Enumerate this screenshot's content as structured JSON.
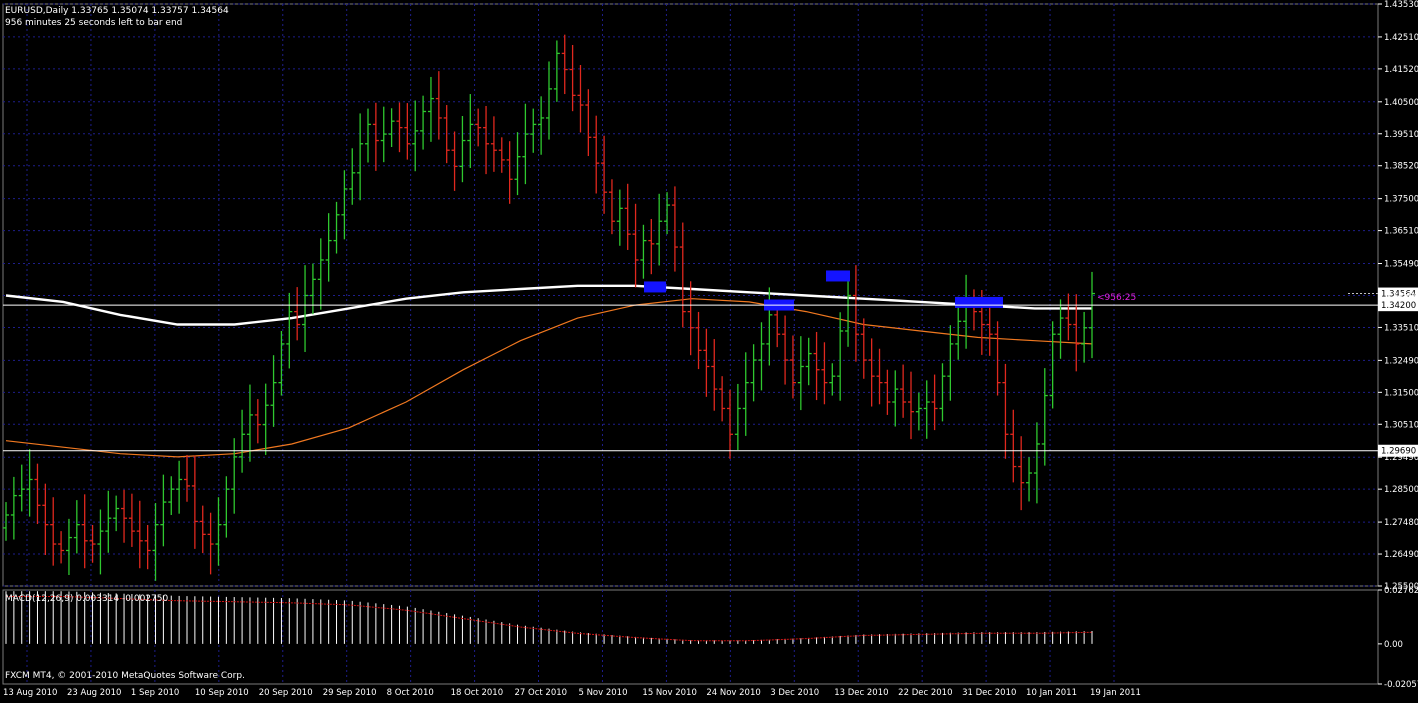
{
  "header": {
    "symbol_line": "EURUSD,Daily  1.33765 1.35074 1.33757 1.34564",
    "timer_line": "956 minutes 25 seconds left to bar end"
  },
  "colors": {
    "background": "#000000",
    "grid": "#1e1e8c",
    "bull_bar": "#2fc82f",
    "bear_bar": "#e0281e",
    "ma_fast": "#ffffff",
    "ma_slow": "#f07820",
    "marker": "#1414ff",
    "price_line": "#ffffff",
    "countdown_text": "#e020e0",
    "macd_hist": "#ffffff",
    "macd_signal": "#d01414",
    "axis_text": "#ffffff"
  },
  "main_chart": {
    "y_ticks": [
      "1.43530",
      "1.42510",
      "1.41520",
      "1.40500",
      "1.39510",
      "1.38520",
      "1.37500",
      "1.36510",
      "1.35490",
      "1.34500",
      "1.33510",
      "1.32490",
      "1.31500",
      "1.30510",
      "1.29490",
      "1.28500",
      "1.27480",
      "1.26490",
      "1.25500"
    ],
    "current_price_label": "1.34564",
    "hline_upper_label": "1.34200",
    "hline_lower_label": "1.29690",
    "countdown_label": "<956:25",
    "ylim": [
      1.255,
      1.4353
    ]
  },
  "macd_panel": {
    "label": "MACD(12,26,9) 0.003314 -0.002750",
    "y_ticks": [
      "0.02762",
      "0.00",
      "-0.02057"
    ]
  },
  "x_axis": {
    "labels": [
      "13 Aug 2010",
      "23 Aug 2010",
      "1 Sep 2010",
      "10 Sep 2010",
      "20 Sep 2010",
      "29 Sep 2010",
      "8 Oct 2010",
      "18 Oct 2010",
      "27 Oct 2010",
      "5 Nov 2010",
      "15 Nov 2010",
      "24 Nov 2010",
      "3 Dec 2010",
      "13 Dec 2010",
      "22 Dec 2010",
      "31 Dec 2010",
      "10 Jan 2011",
      "19 Jan 2011"
    ]
  },
  "copyright": "FXCM MT4, © 2001-2010 MetaQuotes Software Corp.",
  "chart_data": {
    "type": "ohlc",
    "title": "EURUSD,Daily",
    "ylim": [
      1.255,
      1.4353
    ],
    "ohlc_closes": [
      1.277,
      1.283,
      1.285,
      1.288,
      1.28,
      1.274,
      1.268,
      1.266,
      1.27,
      1.274,
      1.269,
      1.268,
      1.272,
      1.276,
      1.279,
      1.276,
      1.272,
      1.269,
      1.266,
      1.274,
      1.281,
      1.285,
      1.288,
      1.286,
      1.275,
      1.271,
      1.268,
      1.274,
      1.285,
      1.295,
      1.302,
      1.308,
      1.305,
      1.311,
      1.318,
      1.33,
      1.34,
      1.336,
      1.345,
      1.35,
      1.356,
      1.362,
      1.37,
      1.378,
      1.383,
      1.392,
      1.398,
      1.393,
      1.395,
      1.399,
      1.397,
      1.392,
      1.396,
      1.402,
      1.406,
      1.4,
      1.39,
      1.385,
      1.393,
      1.398,
      1.397,
      1.392,
      1.39,
      1.387,
      1.381,
      1.388,
      1.395,
      1.398,
      1.4,
      1.409,
      1.42,
      1.415,
      1.407,
      1.404,
      1.394,
      1.386,
      1.377,
      1.368,
      1.372,
      1.364,
      1.356,
      1.362,
      1.361,
      1.368,
      1.373,
      1.36,
      1.34,
      1.335,
      1.328,
      1.323,
      1.316,
      1.31,
      1.302,
      1.31,
      1.318,
      1.325,
      1.33,
      1.339,
      1.333,
      1.325,
      1.318,
      1.323,
      1.327,
      1.322,
      1.318,
      1.32,
      1.334,
      1.345,
      1.333,
      1.325,
      1.32,
      1.318,
      1.312,
      1.316,
      1.312,
      1.309,
      1.31,
      1.312,
      1.31,
      1.32,
      1.33,
      1.337,
      1.342,
      1.34,
      1.336,
      1.333,
      1.318,
      1.302,
      1.292,
      1.287,
      1.29,
      1.299,
      1.314,
      1.333,
      1.338,
      1.336,
      1.33,
      1.335,
      1.3456
    ],
    "series": [
      {
        "values": [
          1.3,
          1.298,
          1.296,
          1.295,
          1.296,
          1.299,
          1.304,
          1.312,
          1.322,
          1.331,
          1.338,
          1.342,
          1.344,
          1.343,
          1.34,
          1.336,
          1.334,
          1.332,
          1.331,
          1.33
        ]
      },
      {
        "values": [
          1.345,
          1.343,
          1.339,
          1.336,
          1.336,
          1.338,
          1.341,
          1.344,
          1.346,
          1.347,
          1.348,
          1.348,
          1.347,
          1.346,
          1.345,
          1.344,
          1.343,
          1.342,
          1.341,
          1.341
        ]
      }
    ],
    "hlines": [
      1.342,
      1.2969
    ],
    "macd": {
      "ylim": [
        -0.02057,
        0.02762
      ],
      "value": 0.003314,
      "signal": -0.00275
    }
  }
}
